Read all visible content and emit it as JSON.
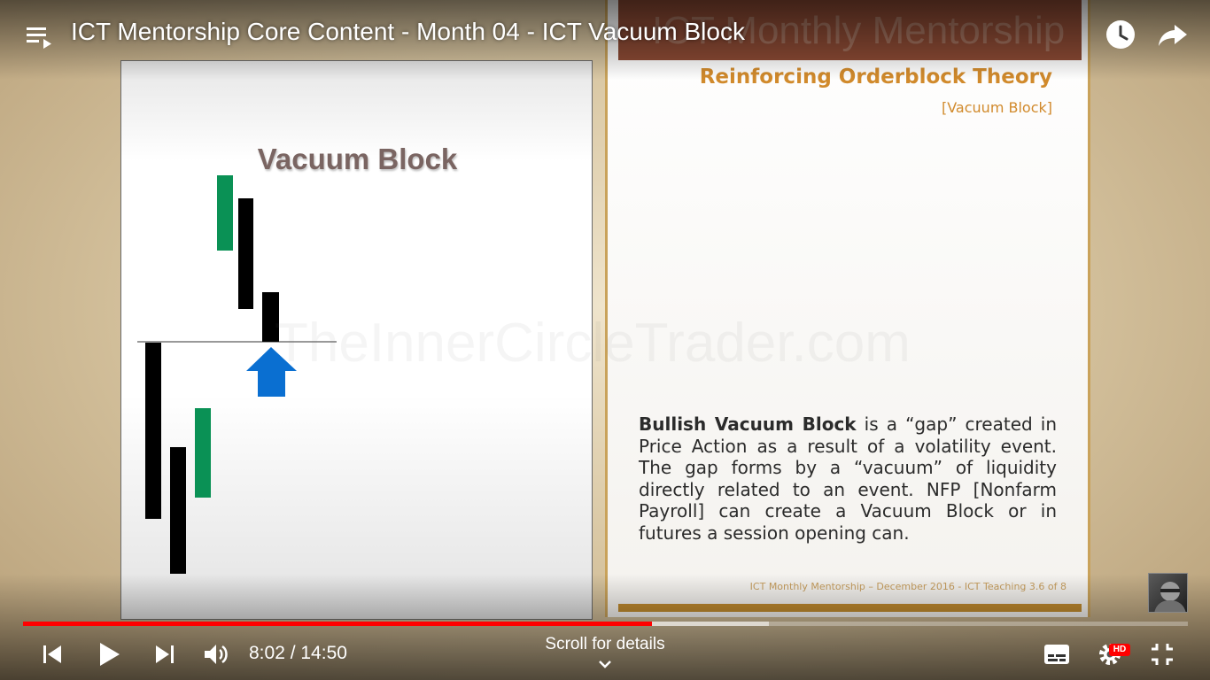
{
  "player": {
    "title": "ICT Mentorship Core Content - Month 04 - ICT Vacuum Block",
    "current_time": "8:02",
    "duration": "14:50",
    "time_display": "8:02 / 14:50",
    "played_fraction": 0.54,
    "buffered_fraction": 0.64,
    "scroll_for_details": "Scroll for details",
    "hd_badge": "HD",
    "icons": [
      "playlist-icon",
      "watch-later-icon",
      "share-icon",
      "previous-icon",
      "play-icon",
      "next-icon",
      "volume-icon",
      "chevron-down-icon",
      "subtitles-icon",
      "settings-icon",
      "exit-fullscreen-icon"
    ],
    "accent_color": "#ff0000"
  },
  "slide_left": {
    "title": "Vacuum Block",
    "candle_colors": {
      "bullish": "#0a9155",
      "bearish": "#000000",
      "arrow": "#0a6fd1"
    }
  },
  "slide_right": {
    "banner_text": "ICT Monthly Mentorship",
    "title": "Reinforcing Orderblock Theory",
    "subtitle": "[Vacuum Block]",
    "body_bold": "Bullish Vacuum Block",
    "body_text": " is a “gap” created in Price Action as a result of a volatility event.  The gap forms by a “vacuum” of liquidity directly related to an event.  NFP [Nonfarm Payroll] can create a Vacuum Block or in futures a session opening can.",
    "footer": "ICT Monthly Mentorship – December 2016 - ICT Teaching 3.6 of 8",
    "accent_color": "#d18a2c"
  },
  "watermark": "TheInnerCircleTrader.com"
}
